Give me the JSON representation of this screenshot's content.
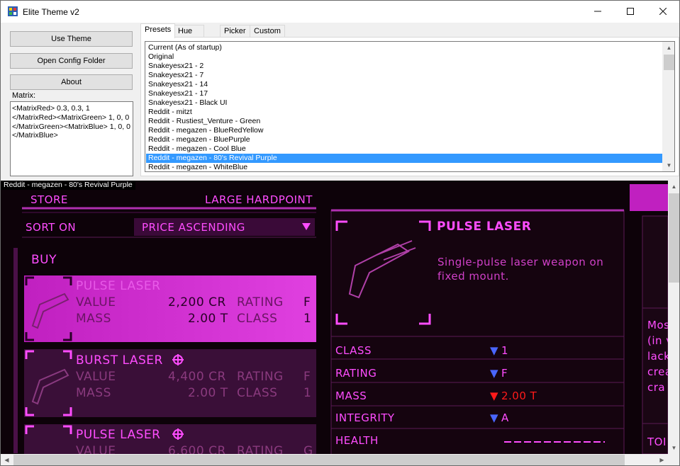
{
  "window": {
    "title": "Elite Theme v2",
    "minimize": "—",
    "maximize": "☐",
    "close": "✕"
  },
  "left": {
    "use_theme": "Use Theme",
    "open_config": "Open Config Folder",
    "about": "About",
    "matrix_label": "Matrix:",
    "matrix_text": "<MatrixRed> 0.3, 0.3, 1\n</MatrixRed><MatrixGreen> 1, 0, 0\n</MatrixGreen><MatrixBlue> 1, 0, 0\n</MatrixBlue>"
  },
  "tabs": [
    "Presets",
    "Hue Picker",
    "Picker",
    "Custom"
  ],
  "presets": {
    "items": [
      "Current (As of startup)",
      "Original",
      "Snakeyesx21 - 2",
      "Snakeyesx21 - 7",
      "Snakeyesx21 - 14",
      "Snakeyesx21 - 17",
      "Snakeyesx21 - Black UI",
      "Reddit - mitzt",
      "Reddit - Rustiest_Venture - Green",
      "Reddit - megazen - BlueRedYellow",
      "Reddit - megazen - BluePurple",
      "Reddit - megazen - Cool Blue",
      "Reddit - megazen - 80's Revival Purple",
      "Reddit - megazen - WhiteBlue"
    ],
    "selected_index": 12
  },
  "preview": {
    "label": "Reddit - megazen - 80's Revival Purple",
    "store": "STORE",
    "large_hardpoint": "LARGE HARDPOINT",
    "sort_on": "SORT ON",
    "sort_value": "PRICE ASCENDING",
    "buy": "BUY",
    "cards": [
      {
        "name": "PULSE LASER",
        "value": "2,200 CR",
        "mass": "2.00 T",
        "rating": "F",
        "class": "1"
      },
      {
        "name": "BURST LASER",
        "value": "4,400 CR",
        "mass": "2.00 T",
        "rating": "F",
        "class": "1"
      },
      {
        "name": "PULSE LASER",
        "value": "6,600 CR",
        "mass": "",
        "rating": "G",
        "class": ""
      }
    ],
    "labels": {
      "value": "VALUE",
      "mass": "MASS",
      "rating": "RATING",
      "class": "CLASS"
    },
    "detail": {
      "title": "PULSE LASER",
      "desc_line1": "Single-pulse laser weapon on",
      "desc_line2": "fixed mount.",
      "stats": [
        {
          "label": "CLASS",
          "value": "1",
          "dir": "▼",
          "color": "#ff4dff"
        },
        {
          "label": "RATING",
          "value": "F",
          "dir": "▼",
          "color": "#ff4dff"
        },
        {
          "label": "MASS",
          "value": "2.00 T",
          "dir": "▼",
          "color": "#ff1a1a"
        },
        {
          "label": "INTEGRITY",
          "value": "A",
          "dir": "▼",
          "color": "#ff4dff"
        },
        {
          "label": "HEALTH",
          "value": "",
          "dir": "",
          "color": "#ff4dff"
        }
      ]
    },
    "side_text": [
      "Mos",
      "(in v",
      "lack",
      "crea",
      "cra"
    ],
    "side_bottom": "TOI"
  }
}
